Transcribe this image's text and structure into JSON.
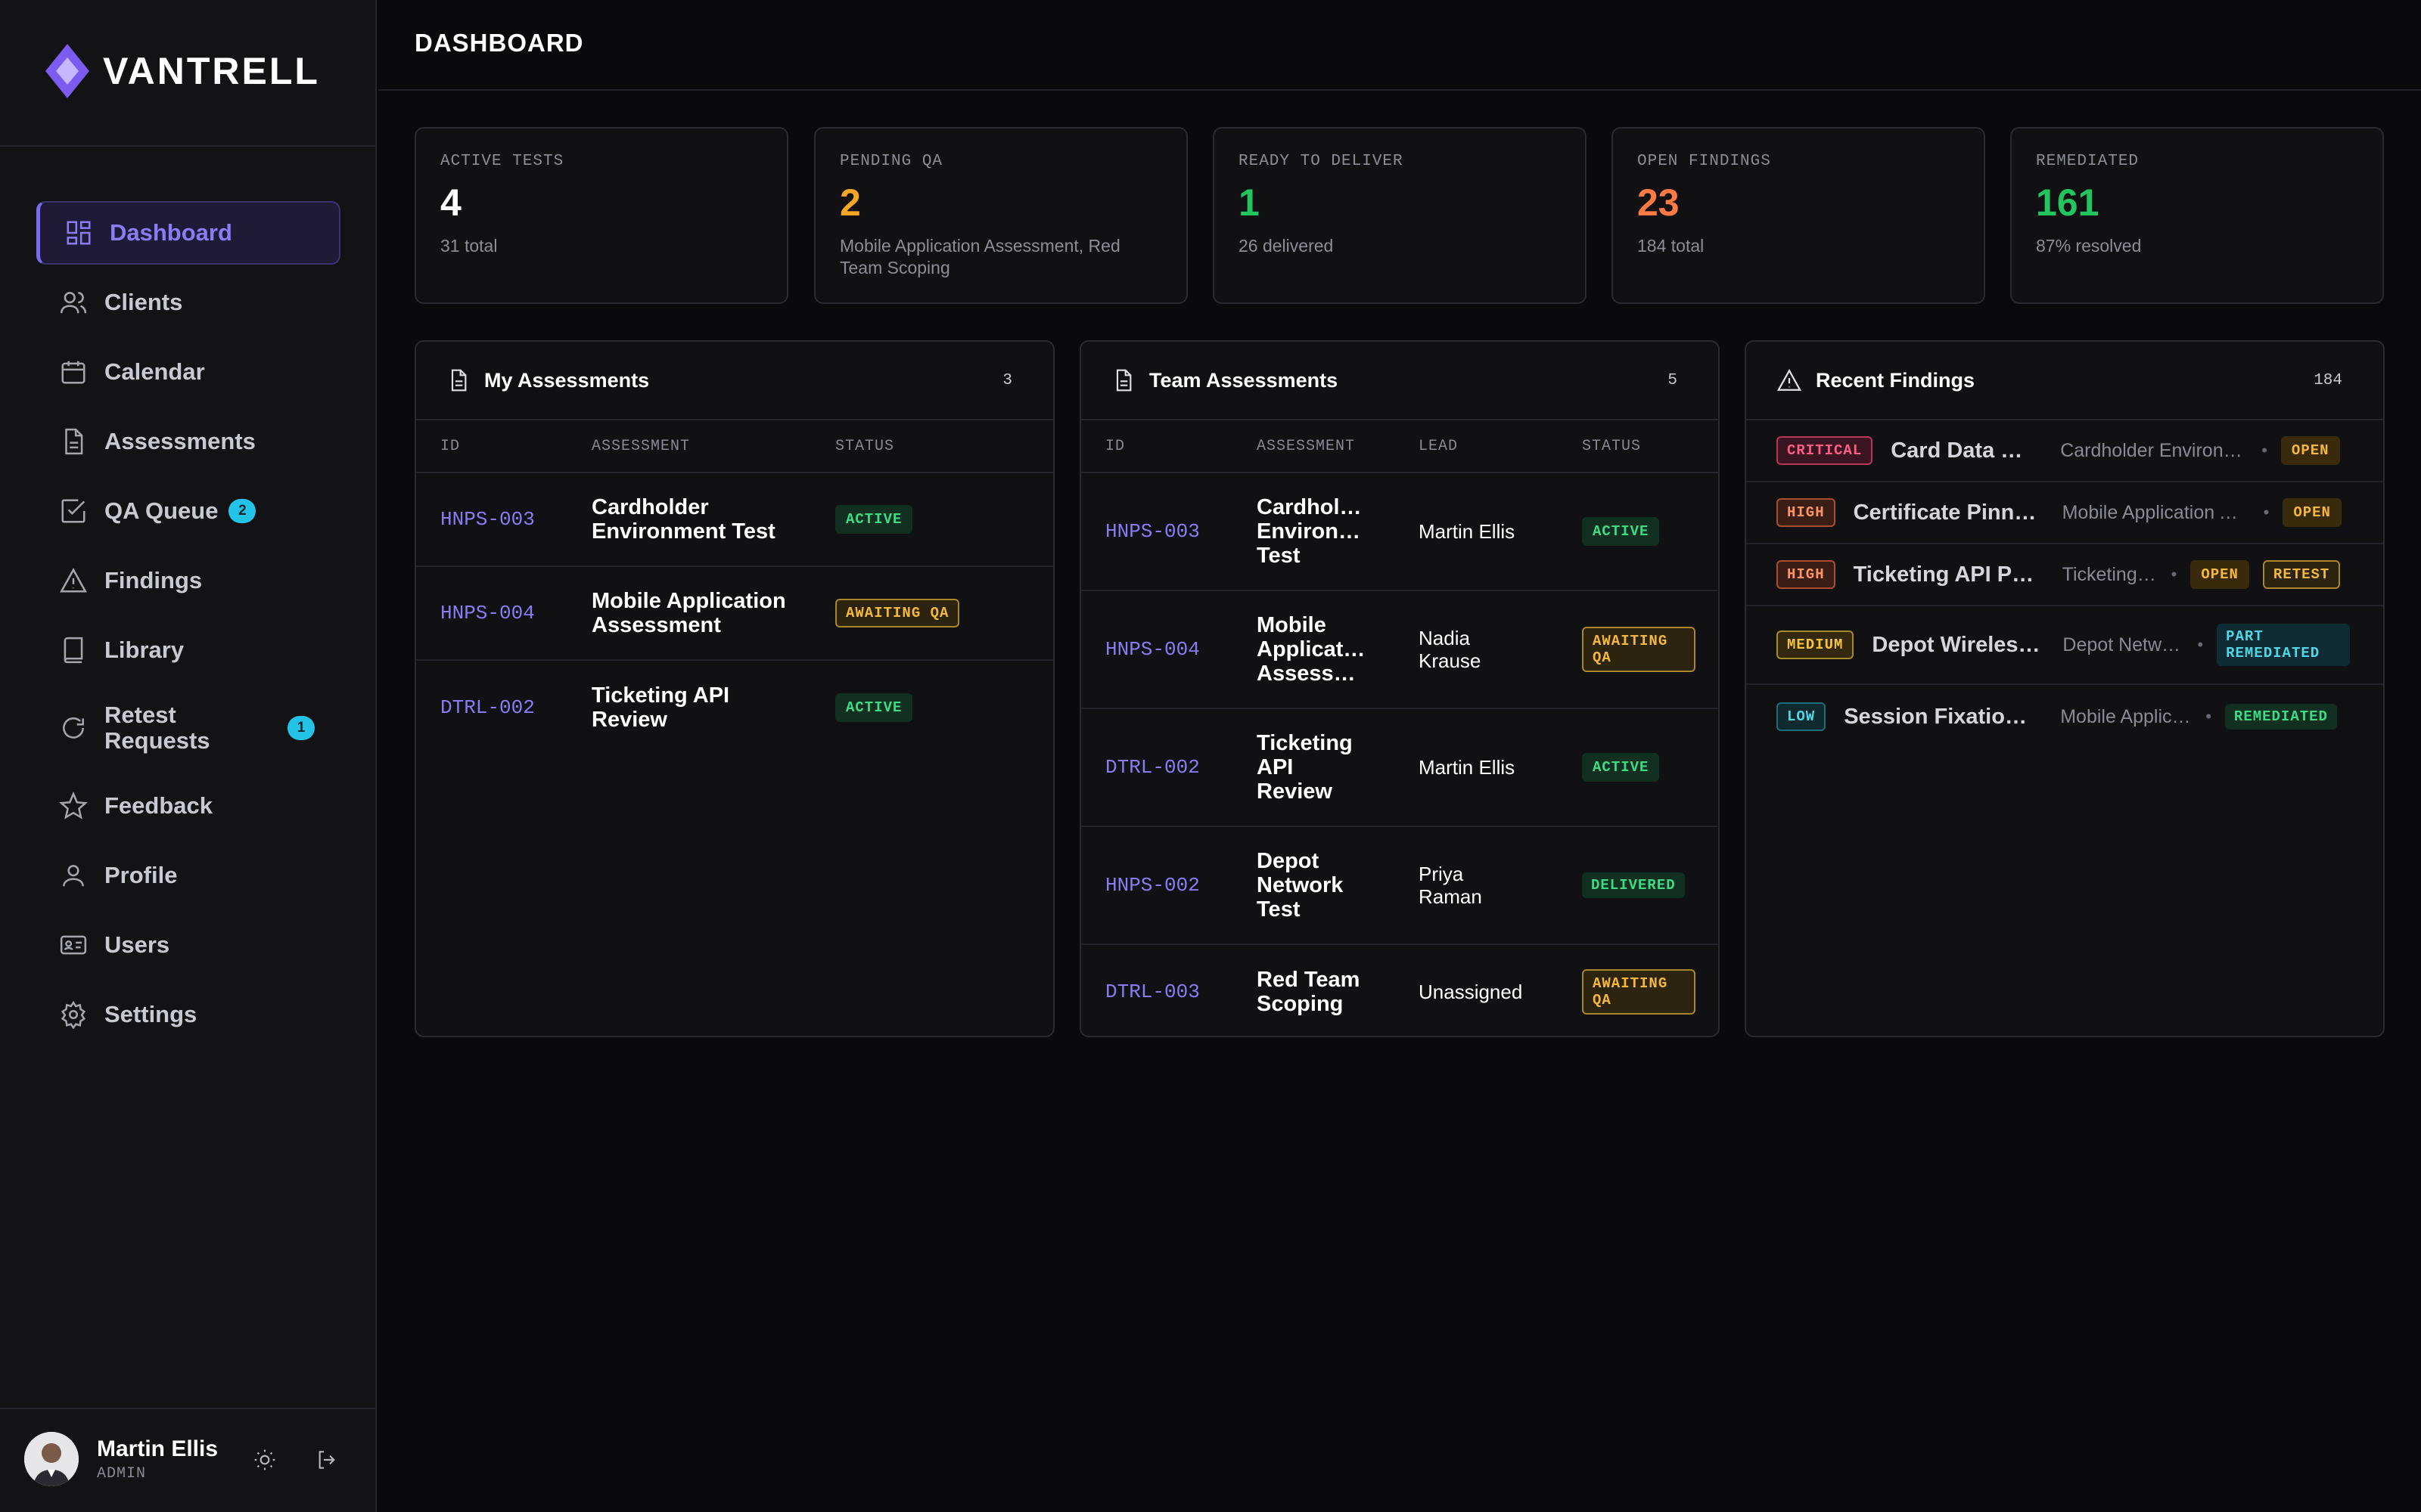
{
  "app": {
    "brand": "VANTRELL",
    "page_title": "DASHBOARD"
  },
  "sidebar": {
    "items": [
      {
        "label": "Dashboard",
        "icon": "dashboard-icon",
        "active": true
      },
      {
        "label": "Clients",
        "icon": "users-icon"
      },
      {
        "label": "Calendar",
        "icon": "calendar-icon"
      },
      {
        "label": "Assessments",
        "icon": "document-icon"
      },
      {
        "label": "QA Queue",
        "icon": "check-square-icon",
        "badge": "2"
      },
      {
        "label": "Findings",
        "icon": "warning-icon"
      },
      {
        "label": "Library",
        "icon": "book-icon"
      },
      {
        "label": "Retest Requests",
        "icon": "refresh-icon",
        "badge": "1"
      },
      {
        "label": "Feedback",
        "icon": "star-icon"
      },
      {
        "label": "Profile",
        "icon": "user-icon"
      },
      {
        "label": "Users",
        "icon": "id-card-icon"
      },
      {
        "label": "Settings",
        "icon": "gear-icon"
      }
    ],
    "user": {
      "name": "Martin Ellis",
      "role": "ADMIN"
    }
  },
  "stats": [
    {
      "label": "ACTIVE TESTS",
      "value": "4",
      "sub": "31 total",
      "color": "#ffffff"
    },
    {
      "label": "PENDING QA",
      "value": "2",
      "sub": "Mobile Application Assessment, Red Team Scoping",
      "color": "#f5a623"
    },
    {
      "label": "READY TO DELIVER",
      "value": "1",
      "sub": "26 delivered",
      "color": "#22c55e"
    },
    {
      "label": "OPEN FINDINGS",
      "value": "23",
      "sub": "184 total",
      "color": "#ff7a45"
    },
    {
      "label": "REMEDIATED",
      "value": "161",
      "sub": "87% resolved",
      "color": "#22c55e"
    }
  ],
  "my_assessments": {
    "title": "My Assessments",
    "count": "3",
    "headers": [
      "ID",
      "ASSESSMENT",
      "STATUS"
    ],
    "rows": [
      {
        "id": "HNPS-003",
        "name": "Cardholder Environment Test",
        "status": "ACTIVE"
      },
      {
        "id": "HNPS-004",
        "name": "Mobile Application Assessment",
        "status": "AWAITING QA"
      },
      {
        "id": "DTRL-002",
        "name": "Ticketing API Review",
        "status": "ACTIVE"
      }
    ]
  },
  "team_assessments": {
    "title": "Team Assessments",
    "count": "5",
    "headers": [
      "ID",
      "ASSESSMENT",
      "LEAD",
      "STATUS"
    ],
    "rows": [
      {
        "id": "HNPS-003",
        "name": "Cardhol… Environ… Test",
        "lead": "Martin Ellis",
        "status": "ACTIVE"
      },
      {
        "id": "HNPS-004",
        "name": "Mobile Applicat… Assess…",
        "lead": "Nadia Krause",
        "status": "AWAITING QA"
      },
      {
        "id": "DTRL-002",
        "name": "Ticketing API Review",
        "lead": "Martin Ellis",
        "status": "ACTIVE"
      },
      {
        "id": "HNPS-002",
        "name": "Depot Network Test",
        "lead": "Priya Raman",
        "status": "DELIVERED"
      },
      {
        "id": "DTRL-003",
        "name": "Red Team Scoping",
        "lead": "Unassigned",
        "status": "AWAITING QA"
      }
    ]
  },
  "recent_findings": {
    "title": "Recent Findings",
    "count": "184",
    "rows": [
      {
        "severity": "CRITICAL",
        "title": "Card Data W…",
        "assessment": "Cardholder Environ…",
        "status": "OPEN"
      },
      {
        "severity": "HIGH",
        "title": "Certificate Pinni…",
        "assessment": "Mobile Application A…",
        "status": "OPEN"
      },
      {
        "severity": "HIGH",
        "title": "Ticketing API Pe…",
        "assessment": "Ticketing…",
        "status": "OPEN",
        "extra": "RETEST"
      },
      {
        "severity": "MEDIUM",
        "title": "Depot Wireles…",
        "assessment": "Depot Netw…",
        "status": "PART REMEDIATED"
      },
      {
        "severity": "LOW",
        "title": "Session Fixation …",
        "assessment": "Mobile Applic…",
        "status": "REMEDIATED"
      }
    ]
  }
}
